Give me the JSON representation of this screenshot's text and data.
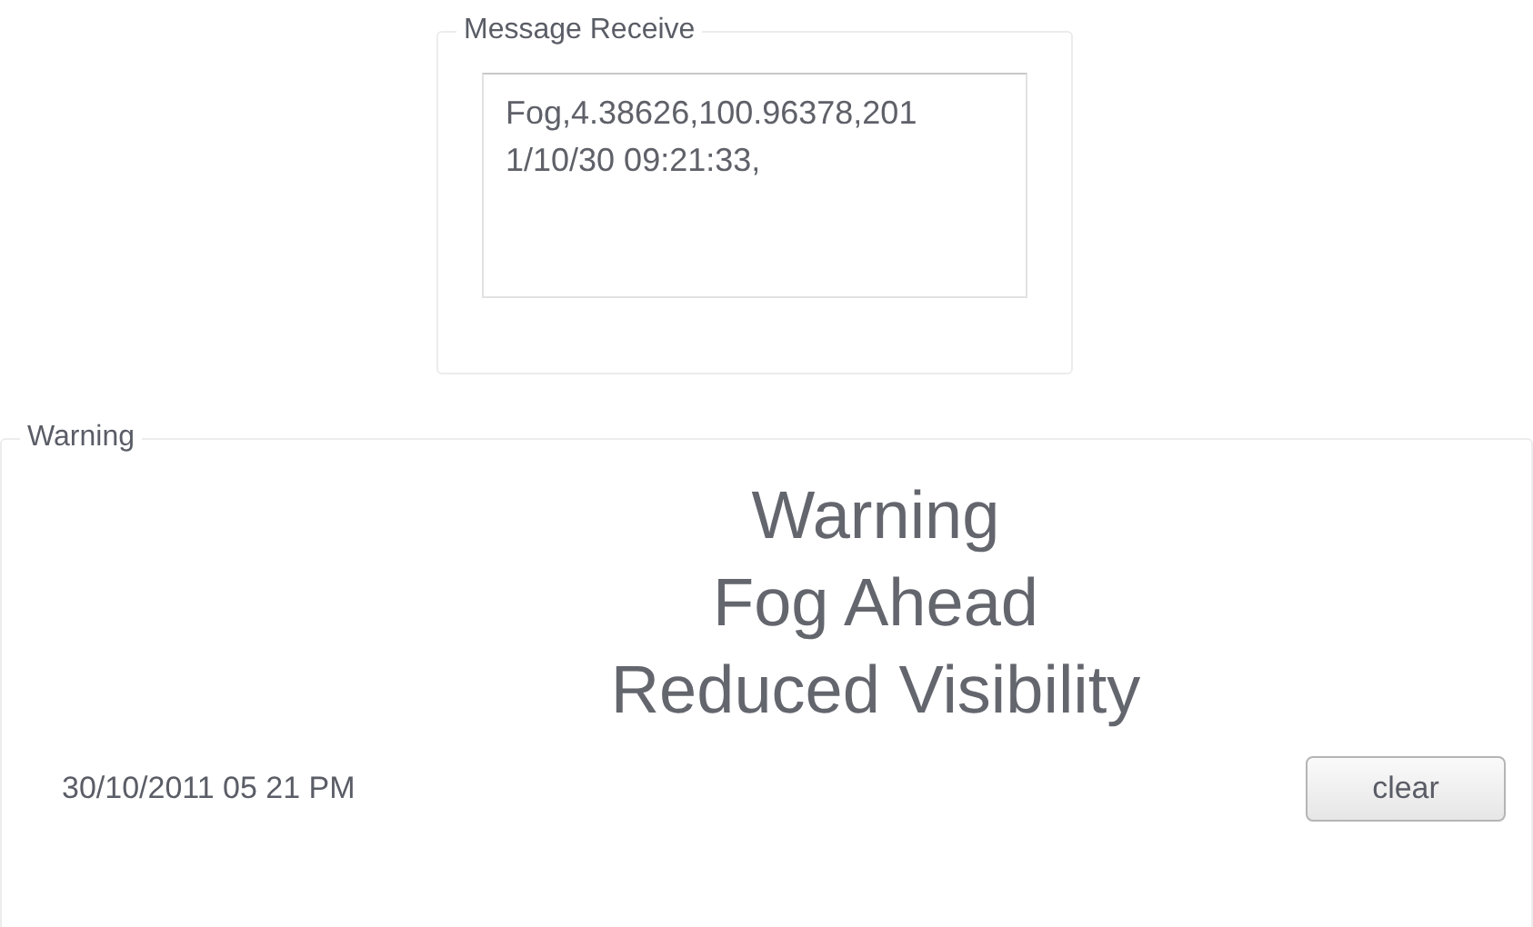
{
  "message_group": {
    "title": "Message Receive",
    "message_lines": [
      "Fog,4.38626,100.96378,201",
      "1/10/30 09:21:33,"
    ]
  },
  "warning_group": {
    "title": "Warning",
    "warning_lines": [
      "Warning",
      "Fog Ahead",
      "Reduced Visibility"
    ],
    "timestamp": "30/10/2011 05 21 PM",
    "clear_button": "clear"
  }
}
